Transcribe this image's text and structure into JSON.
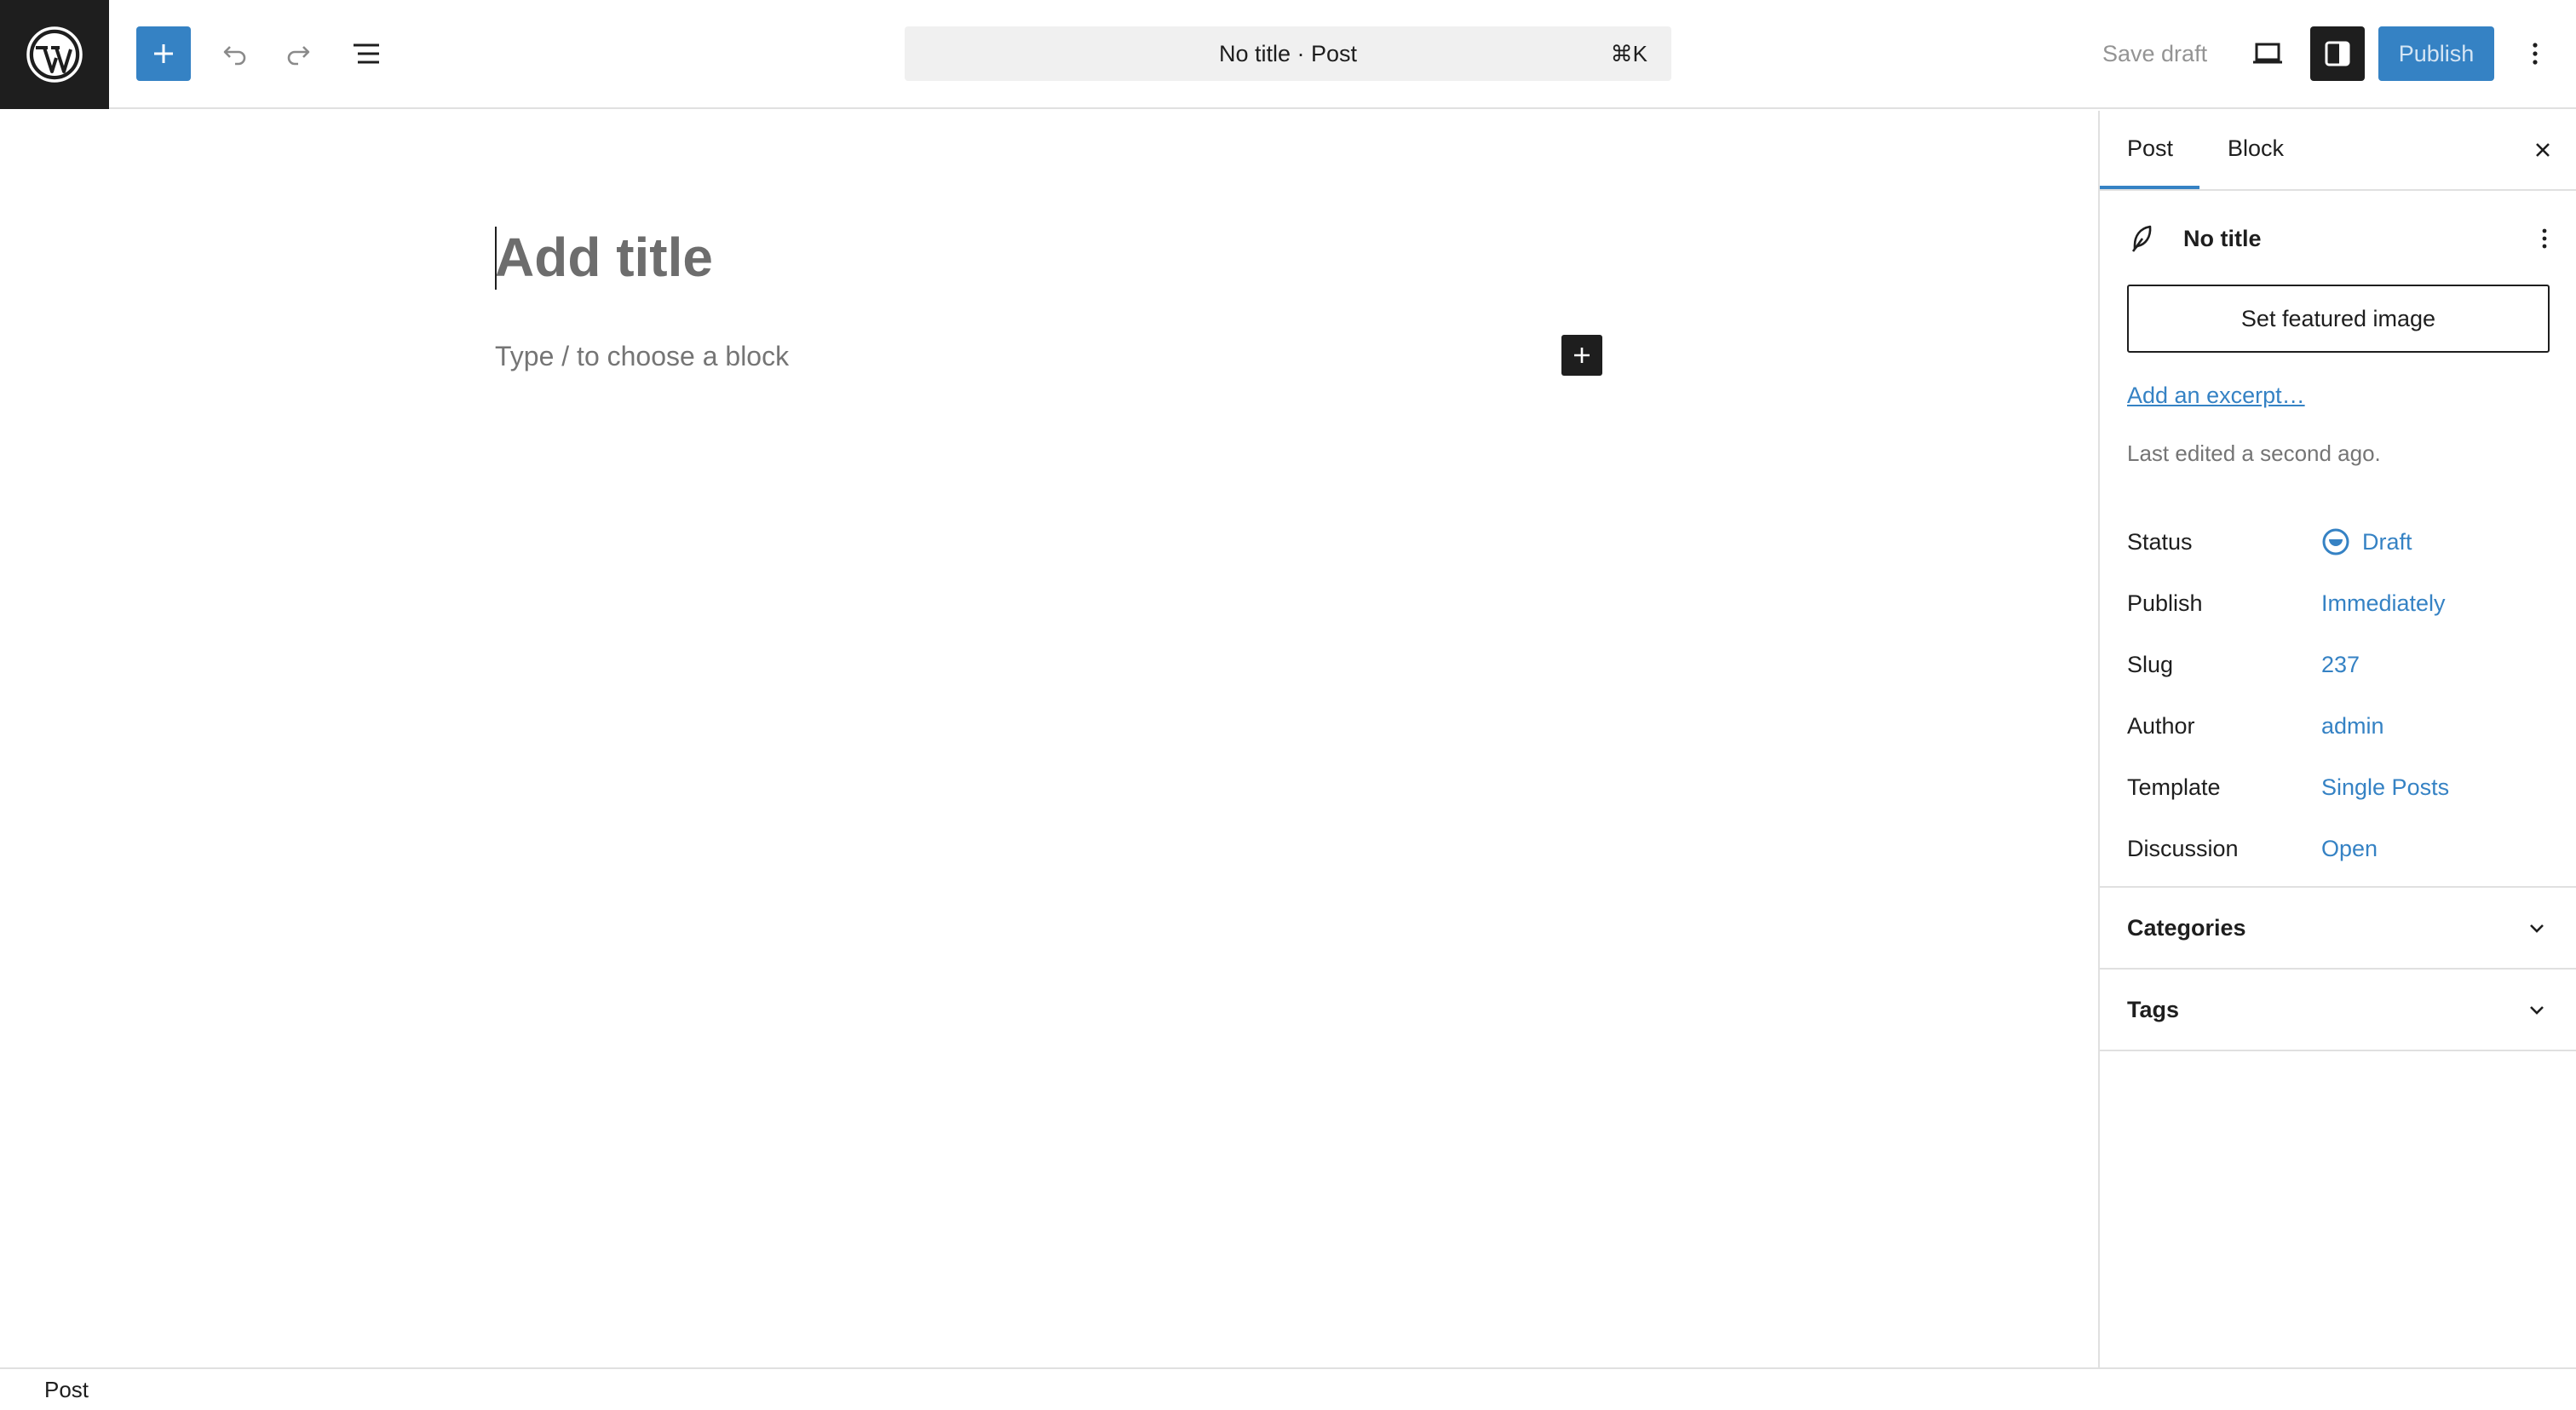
{
  "toolbar": {
    "logo_icon": "wordpress-logo-icon",
    "inserter_icon": "plus-icon",
    "undo_icon": "undo-icon",
    "redo_icon": "redo-icon",
    "list_view_icon": "list-view-icon",
    "document_title": "No title · Post",
    "shortcut": "⌘K",
    "save_draft_label": "Save draft",
    "preview_icon": "desktop-icon",
    "settings_icon": "sidebar-toggle-icon",
    "publish_label": "Publish",
    "options_icon": "more-vertical-icon",
    "accent_color": "#3582c4"
  },
  "editor": {
    "title_placeholder": "Add title",
    "block_placeholder": "Type / to choose a block",
    "block_inserter_icon": "plus-icon"
  },
  "sidebar": {
    "tabs": [
      {
        "label": "Post",
        "active": true
      },
      {
        "label": "Block",
        "active": false
      }
    ],
    "close_icon": "close-icon",
    "document": {
      "icon": "post-feather-icon",
      "title": "No title",
      "menu_icon": "more-vertical-icon"
    },
    "featured_image_label": "Set featured image",
    "excerpt_link": "Add an excerpt…",
    "last_edited": "Last edited a second ago.",
    "meta": [
      {
        "label": "Status",
        "value": "Draft"
      },
      {
        "label": "Publish",
        "value": "Immediately"
      },
      {
        "label": "Slug",
        "value": "237"
      },
      {
        "label": "Author",
        "value": "admin"
      },
      {
        "label": "Template",
        "value": "Single Posts"
      },
      {
        "label": "Discussion",
        "value": "Open"
      }
    ],
    "panels": [
      {
        "title": "Categories",
        "expanded": false
      },
      {
        "title": "Tags",
        "expanded": false
      }
    ]
  },
  "footer": {
    "breadcrumb": "Post"
  }
}
